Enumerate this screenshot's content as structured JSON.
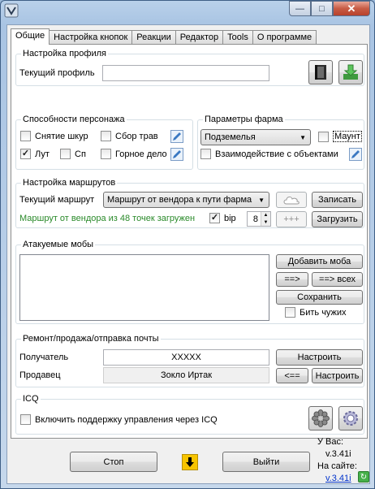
{
  "window": {
    "title": "",
    "minimize": "—",
    "maximize": "□",
    "close": "✕"
  },
  "tabs": [
    "Общие",
    "Настройка кнопок",
    "Реакции",
    "Редактор",
    "Tools",
    "О программе"
  ],
  "profile": {
    "title": "Настройка профиля",
    "current_label": "Текущий профиль",
    "current_value": ""
  },
  "abilities": {
    "title": "Способности персонажа",
    "skinning": {
      "label": "Снятие шкур",
      "checked": false
    },
    "herbs": {
      "label": "Сбор трав",
      "checked": false
    },
    "loot": {
      "label": "Лут",
      "checked": true
    },
    "sp": {
      "label": "Сп",
      "checked": false
    },
    "mining": {
      "label": "Горное дело",
      "checked": false
    }
  },
  "farm": {
    "title": "Параметры фарма",
    "location": "Подземелья",
    "mount": {
      "label": "Маунт",
      "checked": false
    },
    "interact": {
      "label": "Взаимодействие с объектами",
      "checked": false
    }
  },
  "routes": {
    "title": "Настройка маршрутов",
    "current_label": "Текущий маршрут",
    "current_value": "Маршрут от вендора к пути фарма",
    "write_button": "Записать",
    "status": "Маршрут от вендора из 48 точек загружен",
    "bip": {
      "label": "bip",
      "checked": true
    },
    "bip_value": "8",
    "plus_button": "+++",
    "load_button": "Загрузить",
    "status_color": "#2a8a2a"
  },
  "mobs": {
    "title": "Атакуемые мобы",
    "add_button": "Добавить моба",
    "arrow_button": "==>",
    "arrow_all_button": "==> всех",
    "save_button": "Сохранить",
    "hit_others": {
      "label": "Бить чужих",
      "checked": false
    }
  },
  "repair": {
    "title": "Ремонт/продажа/отправка почты",
    "recipient_label": "Получатель",
    "recipient_value": "XXXXX",
    "setup_button": "Настроить",
    "seller_label": "Продавец",
    "seller_value": "Зокло Иртак",
    "back_button": "<==",
    "setup2_button": "Настроить"
  },
  "icq": {
    "title": "ICQ",
    "enable": {
      "label": "Включить поддержку управления через ICQ",
      "checked": false
    }
  },
  "footer": {
    "stop_button": "Стоп",
    "exit_button": "Выйти",
    "have_label": "У Вас:",
    "have_version": "v.3.41i",
    "site_label": "На сайте:",
    "site_version": "v.3.41i"
  }
}
